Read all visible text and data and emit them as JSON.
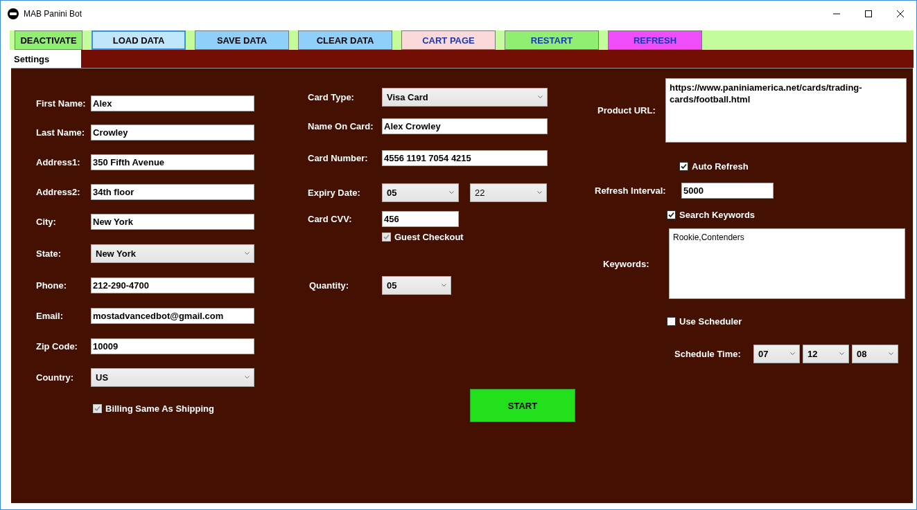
{
  "window": {
    "title": "MAB Panini Bot"
  },
  "toolbar": [
    {
      "label": "DEACTIVATE",
      "kind": "action",
      "color": "#90ee70",
      "focused": false
    },
    {
      "label": "LOAD DATA",
      "kind": "action",
      "color": "#bfe6fb",
      "focused": true
    },
    {
      "label": "SAVE DATA",
      "kind": "action",
      "color": "#8fd0fb",
      "focused": false
    },
    {
      "label": "CLEAR DATA",
      "kind": "action",
      "color": "#8fd0fb",
      "focused": false
    },
    {
      "label": "CART PAGE",
      "kind": "nav",
      "color": "#fcd9d9",
      "focused": false
    },
    {
      "label": "RESTART",
      "kind": "nav",
      "color": "#90ee70",
      "focused": false
    },
    {
      "label": "REFRESH",
      "kind": "nav",
      "color": "#f04cf9",
      "focused": false
    }
  ],
  "tabs": [
    {
      "label": "Settings",
      "selected": true
    }
  ],
  "shipping": [
    {
      "label": "First Name:",
      "kind": "text",
      "value": "Alex"
    },
    {
      "label": "Last Name:",
      "kind": "text",
      "value": "Crowley"
    },
    {
      "label": "Address1:",
      "kind": "text",
      "value": "350 Fifth Avenue"
    },
    {
      "label": "Address2:",
      "kind": "text",
      "value": "34th floor"
    },
    {
      "label": "City:",
      "kind": "text",
      "value": "New York"
    },
    {
      "label": "State:",
      "kind": "select",
      "value": "New York"
    },
    {
      "label": "Phone:",
      "kind": "text",
      "value": "212-290-4700"
    },
    {
      "label": "Email:",
      "kind": "text",
      "value": "mostadvancedbot@gmail.com"
    },
    {
      "label": "Zip Code:",
      "kind": "text",
      "value": "10009"
    },
    {
      "label": "Country:",
      "kind": "select",
      "value": "US"
    },
    {
      "label": "Billing Same As Shipping",
      "kind": "checkbox",
      "checked": true,
      "disabled": true
    }
  ],
  "payment": [
    {
      "label": "Card Type:",
      "kind": "select",
      "values": [
        "Visa Card"
      ]
    },
    {
      "label": "Name On Card:",
      "kind": "text",
      "values": [
        "Alex Crowley"
      ]
    },
    {
      "label": "Card Number:",
      "kind": "text",
      "values": [
        "4556 1191 7054 4215"
      ]
    },
    {
      "label": "Expiry Date:",
      "kind": "select",
      "values": [
        "05",
        "22"
      ]
    },
    {
      "label": "Card CVV:",
      "kind": "text",
      "values": [
        "456"
      ]
    },
    {
      "label": "Guest Checkout",
      "kind": "checkbox",
      "checked": true,
      "disabled": true
    },
    {
      "label": "Quantity:",
      "kind": "select",
      "values": [
        "05"
      ]
    }
  ],
  "start_button": "START",
  "monitor": {
    "product_url": {
      "label": "Product URL:",
      "value": "https://www.paniniamerica.net/cards/trading-cards/football.html"
    },
    "auto_refresh": {
      "label": "Auto Refresh",
      "checked": true,
      "disabled": false
    },
    "refresh_interval": {
      "label": "Refresh Interval:",
      "value": "5000"
    },
    "search_keywords": {
      "label": "Search Keywords",
      "checked": true,
      "disabled": false
    },
    "keywords": {
      "label": "Keywords:",
      "value": "Rookie,Contenders"
    },
    "use_scheduler": {
      "label": "Use Scheduler",
      "checked": false,
      "disabled": false
    },
    "schedule_time": {
      "label": "Schedule Time:",
      "values": [
        "07",
        "12",
        "08"
      ]
    }
  }
}
